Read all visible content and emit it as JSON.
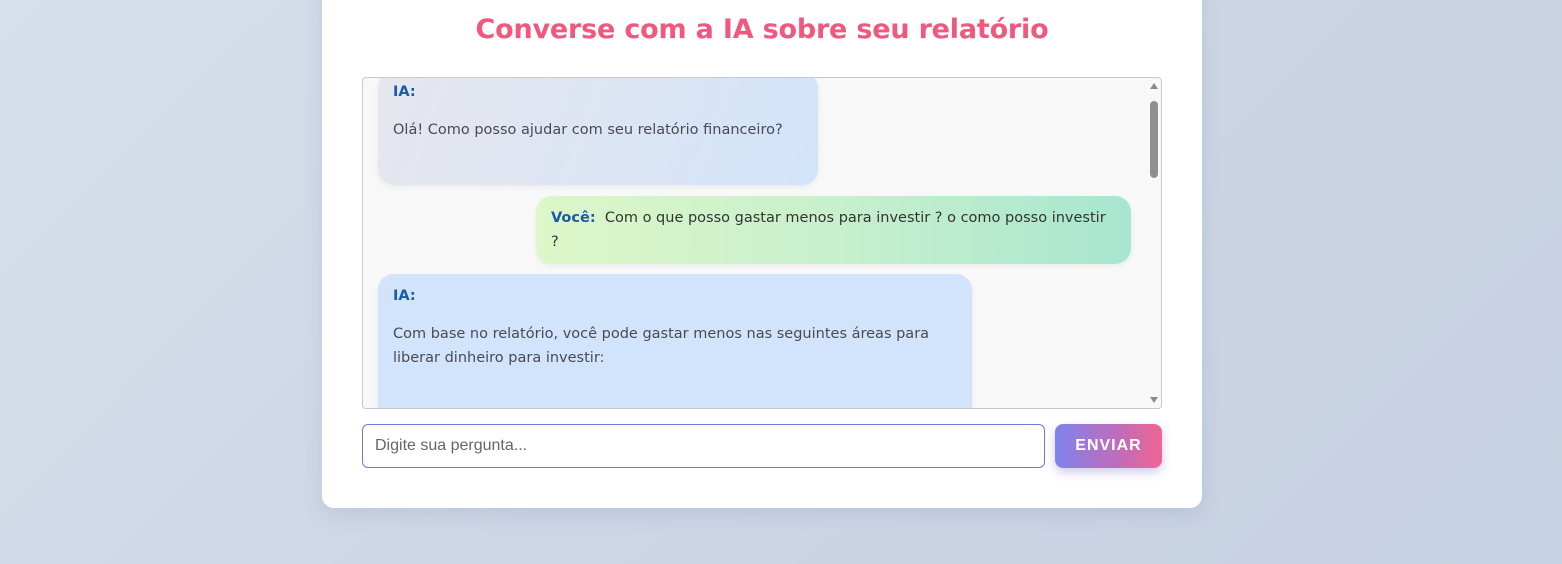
{
  "page": {
    "title": "Converse com a IA sobre seu relatório"
  },
  "chat": {
    "messages": [
      {
        "sender": "IA:",
        "paragraphs": [
          "Olá! Como posso ajudar com seu relatório financeiro?"
        ]
      },
      {
        "sender": "Você:",
        "text": "Com o que posso gastar menos para investir ? o como posso investir ?"
      },
      {
        "sender": "IA:",
        "paragraphs": [
          "Com base no relatório, você pode gastar menos nas seguintes áreas para liberar dinheiro para investir:"
        ]
      }
    ]
  },
  "composer": {
    "placeholder": "Digite sua pergunta...",
    "send_label": "ENVIAR"
  },
  "colors": {
    "title": "#f2577e",
    "sender": "#1a5aa8",
    "input_border": "#6b7bd6",
    "button_gradient_start": "#7f83ec",
    "button_gradient_end": "#f06592"
  },
  "icons": {
    "scroll_up": "triangle-up",
    "scroll_down": "triangle-down"
  }
}
